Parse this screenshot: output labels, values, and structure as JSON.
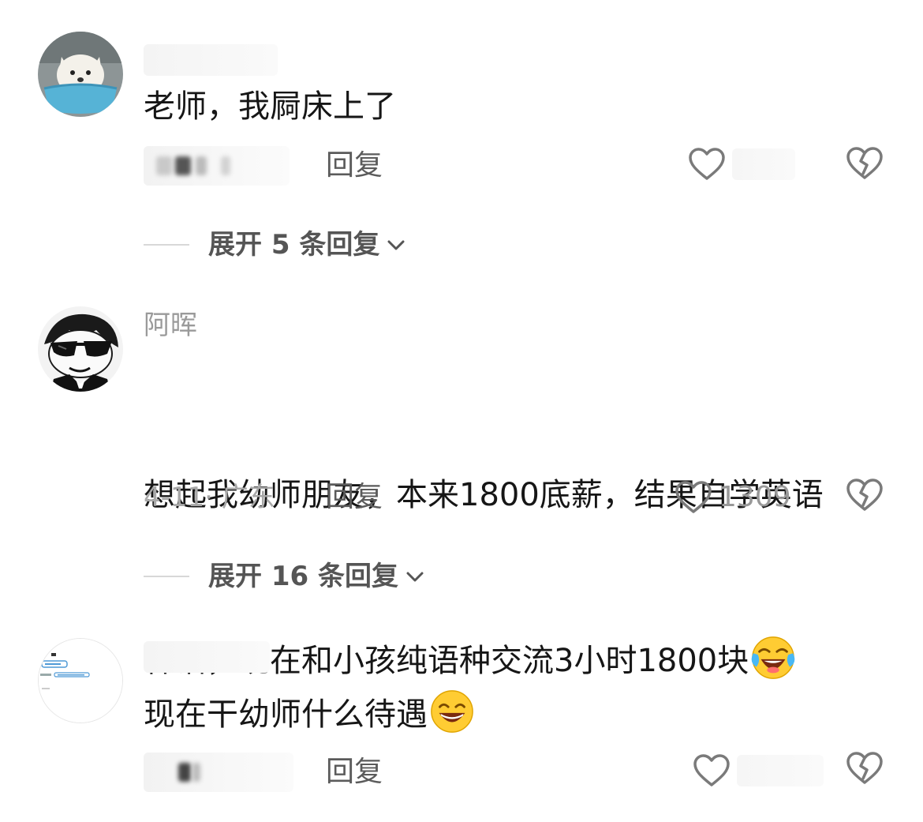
{
  "comments": [
    {
      "username": "",
      "text": "老师，我屙床上了",
      "meta": "",
      "reply_label": "回复",
      "like_count": "",
      "expand_label": "展开 5 条回复",
      "avatar_icon": "dog-in-tub-avatar"
    },
    {
      "username": "阿晖",
      "text_line1": "想起我幼师朋友，本来1800底薪，结果自学英语",
      "text_line2": "韩语，现在和小孩纯语种交流3小时1800块",
      "meta": "4-11· 广东",
      "reply_label": "回复",
      "like_count": "1309",
      "expand_label": "展开 16 条回复",
      "avatar_icon": "sunglasses-cartoon-avatar",
      "emoji": "laughing-crying-emoji"
    },
    {
      "username": "",
      "text": "现在干幼师什么待遇",
      "meta": "",
      "reply_label": "回复",
      "like_count": "",
      "avatar_icon": "screenshot-avatar",
      "emoji": "grinning-emoji"
    }
  ],
  "icons": {
    "like": "heart-outline-icon",
    "dislike": "broken-heart-icon",
    "expand": "chevron-down-icon"
  },
  "colors": {
    "text": "#161616",
    "meta": "#a8a8a8",
    "reply": "#5b5b5b",
    "expand": "#555555",
    "icon": "#7a7a7a"
  }
}
